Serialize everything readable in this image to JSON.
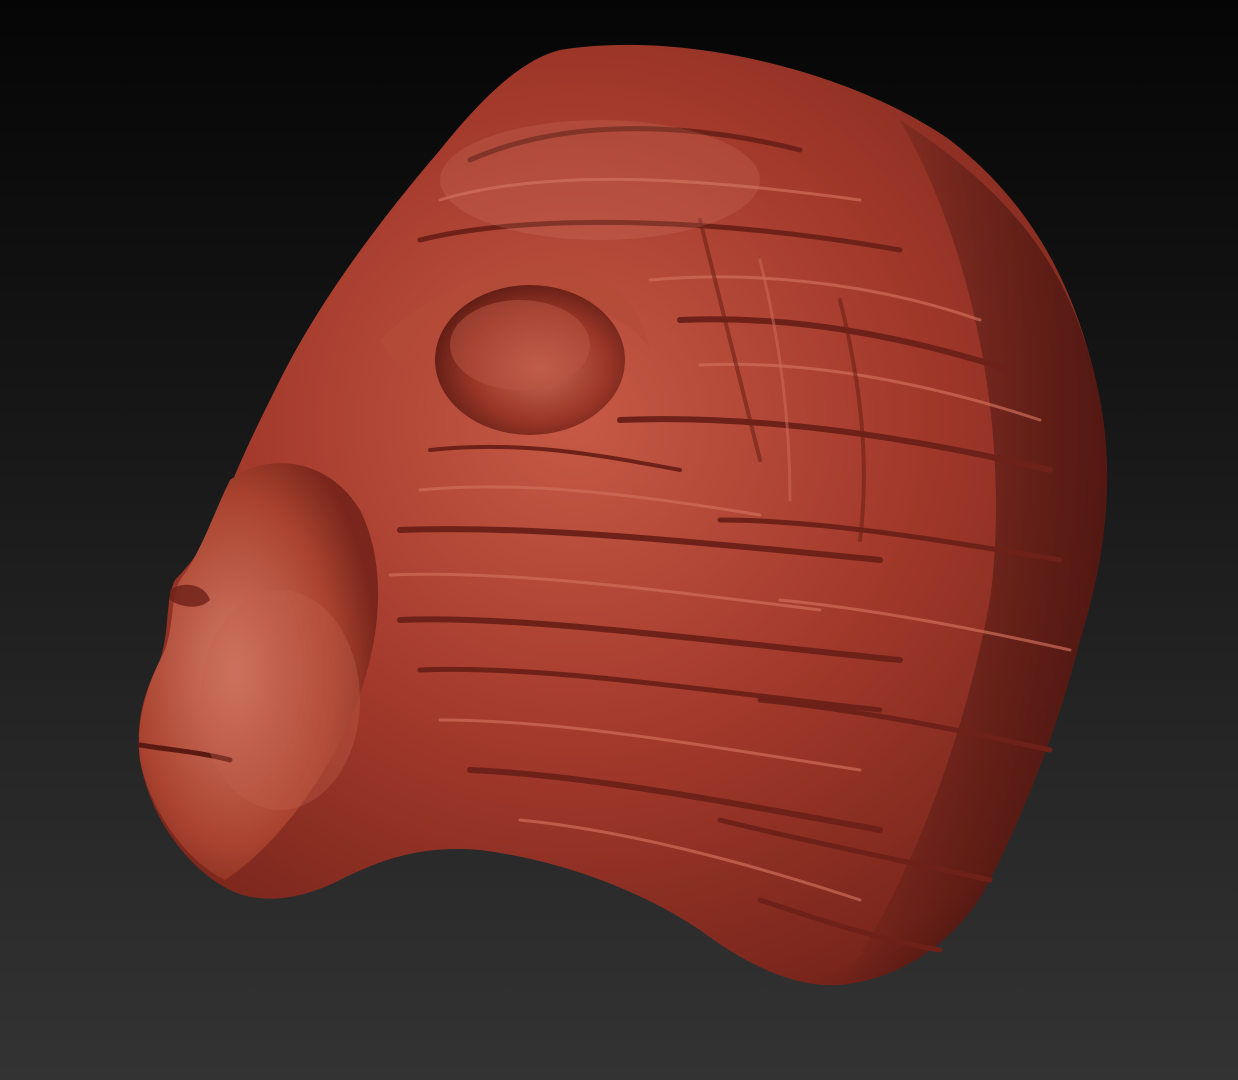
{
  "app": {
    "view": "3d-sculpt-viewport"
  },
  "viewport": {
    "background_top": "#050505",
    "background_bottom": "#333333",
    "material_base": "#a43a2c",
    "material_shadow": "#5a1a12",
    "material_highlight": "#d27a66"
  },
  "model": {
    "subject": "primate-head-sculpt",
    "visible_text": []
  }
}
